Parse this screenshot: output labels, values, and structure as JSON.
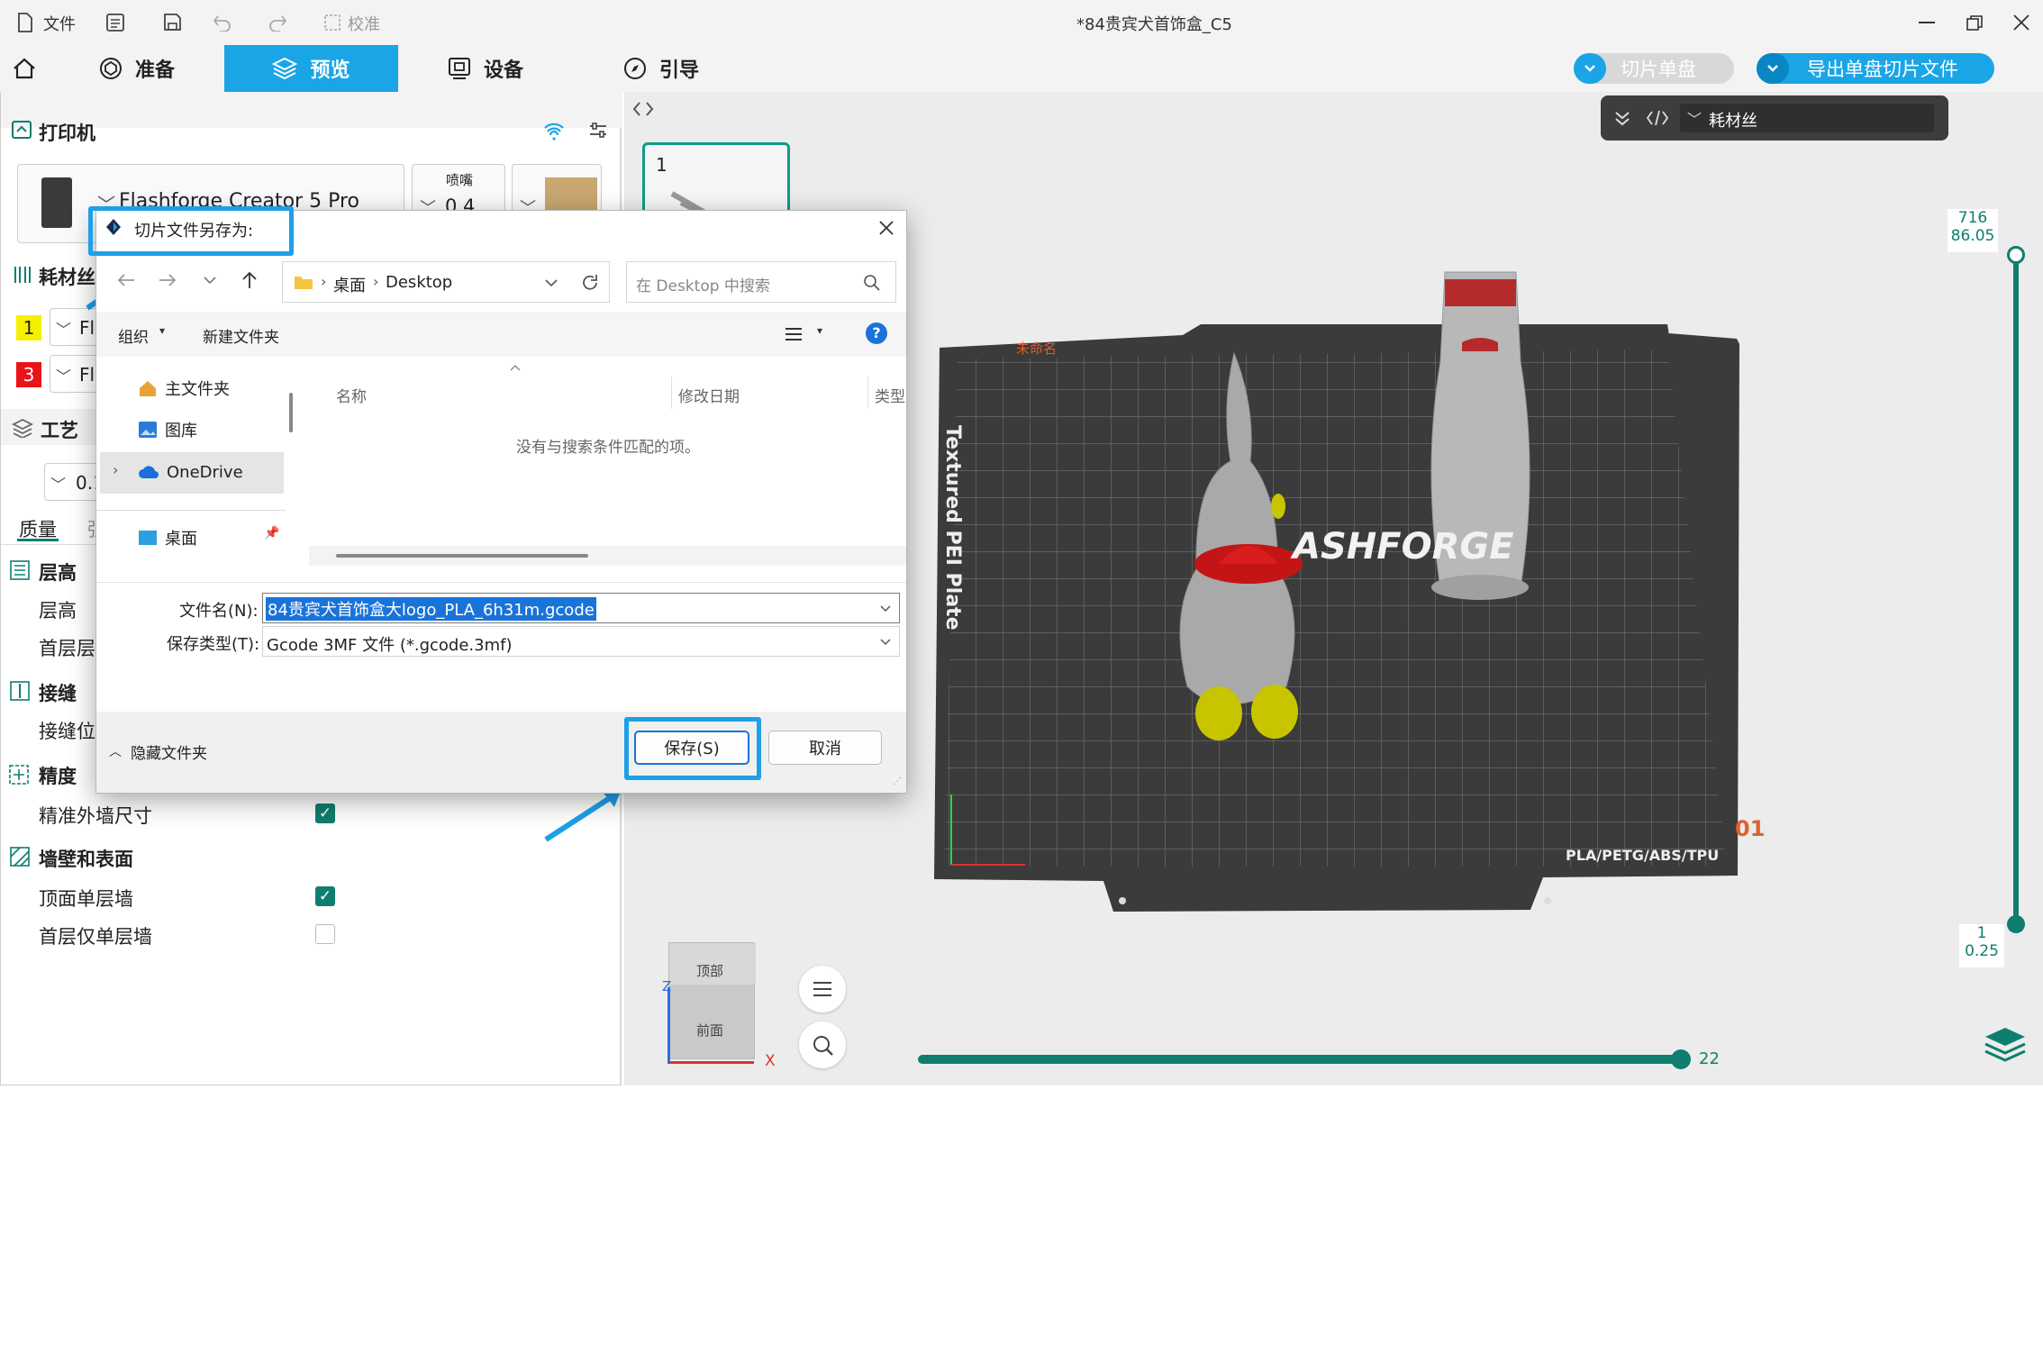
{
  "titlebar": {
    "file_label": "文件",
    "verify_label": "校准",
    "window_title": "*84贵宾犬首饰盒_C5"
  },
  "tabs": {
    "prepare": "准备",
    "preview": "预览",
    "device": "设备",
    "guide": "引导"
  },
  "actions": {
    "slice_plate": "切片单盘",
    "export_slice": "导出单盘切片文件"
  },
  "left": {
    "printer_header": "打印机",
    "printer_name": "Flashforge Creator 5 Pro",
    "nozzle_label": "喷嘴",
    "nozzle_value": "0.4",
    "filament_header": "耗材丝",
    "filament_slots": [
      {
        "num": "1",
        "color": "#f5f000",
        "name": "Fl"
      },
      {
        "num": "3",
        "color": "#e8141a",
        "name": "Fl"
      }
    ],
    "process_header": "工艺",
    "process_value": "0.1",
    "quality_tab": "质量",
    "strength_tab": "强",
    "layer_height_header": "层高",
    "layer_height": "层高",
    "first_layer_height": "首层层",
    "seam_header": "接缝",
    "seam_position": "接缝位",
    "precision_header": "精度",
    "precise_wall": "精准外墙尺寸",
    "wall_surface_header": "墙壁和表面",
    "top_one_wall": "顶面单层墙",
    "first_layer_one_wall": "首层仅单层墙"
  },
  "viewport": {
    "plate_number": "1",
    "filament_bar_label": "耗材丝",
    "top_layer": "716",
    "top_height": "86.05",
    "bottom_layer": "1",
    "bottom_height": "0.25",
    "horizontal_value": "22",
    "plate_text": "Textured PEI Plate",
    "plate_brand": "ASHFORGE",
    "plate_materials": "PLA/PETG/ABS/TPU",
    "unnamed_label": "未命名",
    "plate_corner": "01",
    "cube_top": "顶部",
    "cube_front": "前面",
    "axis_x": "X",
    "axis_z": "Z"
  },
  "dialog": {
    "title": "切片文件另存为:",
    "path_desktop_cn": "桌面",
    "path_desktop": "Desktop",
    "search_placeholder": "在 Desktop 中搜索",
    "organize": "组织",
    "new_folder": "新建文件夹",
    "nav_items": [
      "主文件夹",
      "图库",
      "OneDrive",
      "桌面"
    ],
    "col_name": "名称",
    "col_modified": "修改日期",
    "col_type": "类型",
    "empty_message": "没有与搜索条件匹配的项。",
    "filename_label": "文件名(N):",
    "filename_value": "84贵宾犬首饰盒大logo_PLA_6h31m.gcode",
    "filetype_label": "保存类型(T):",
    "filetype_value": "Gcode 3MF 文件 (*.gcode.3mf)",
    "hide_folders": "隐藏文件夹",
    "save_button": "保存(S)",
    "cancel_button": "取消"
  },
  "colors": {
    "accent": "#1aa5e7",
    "teal": "#0f7e6e",
    "highlight": "#1ea0e8"
  }
}
